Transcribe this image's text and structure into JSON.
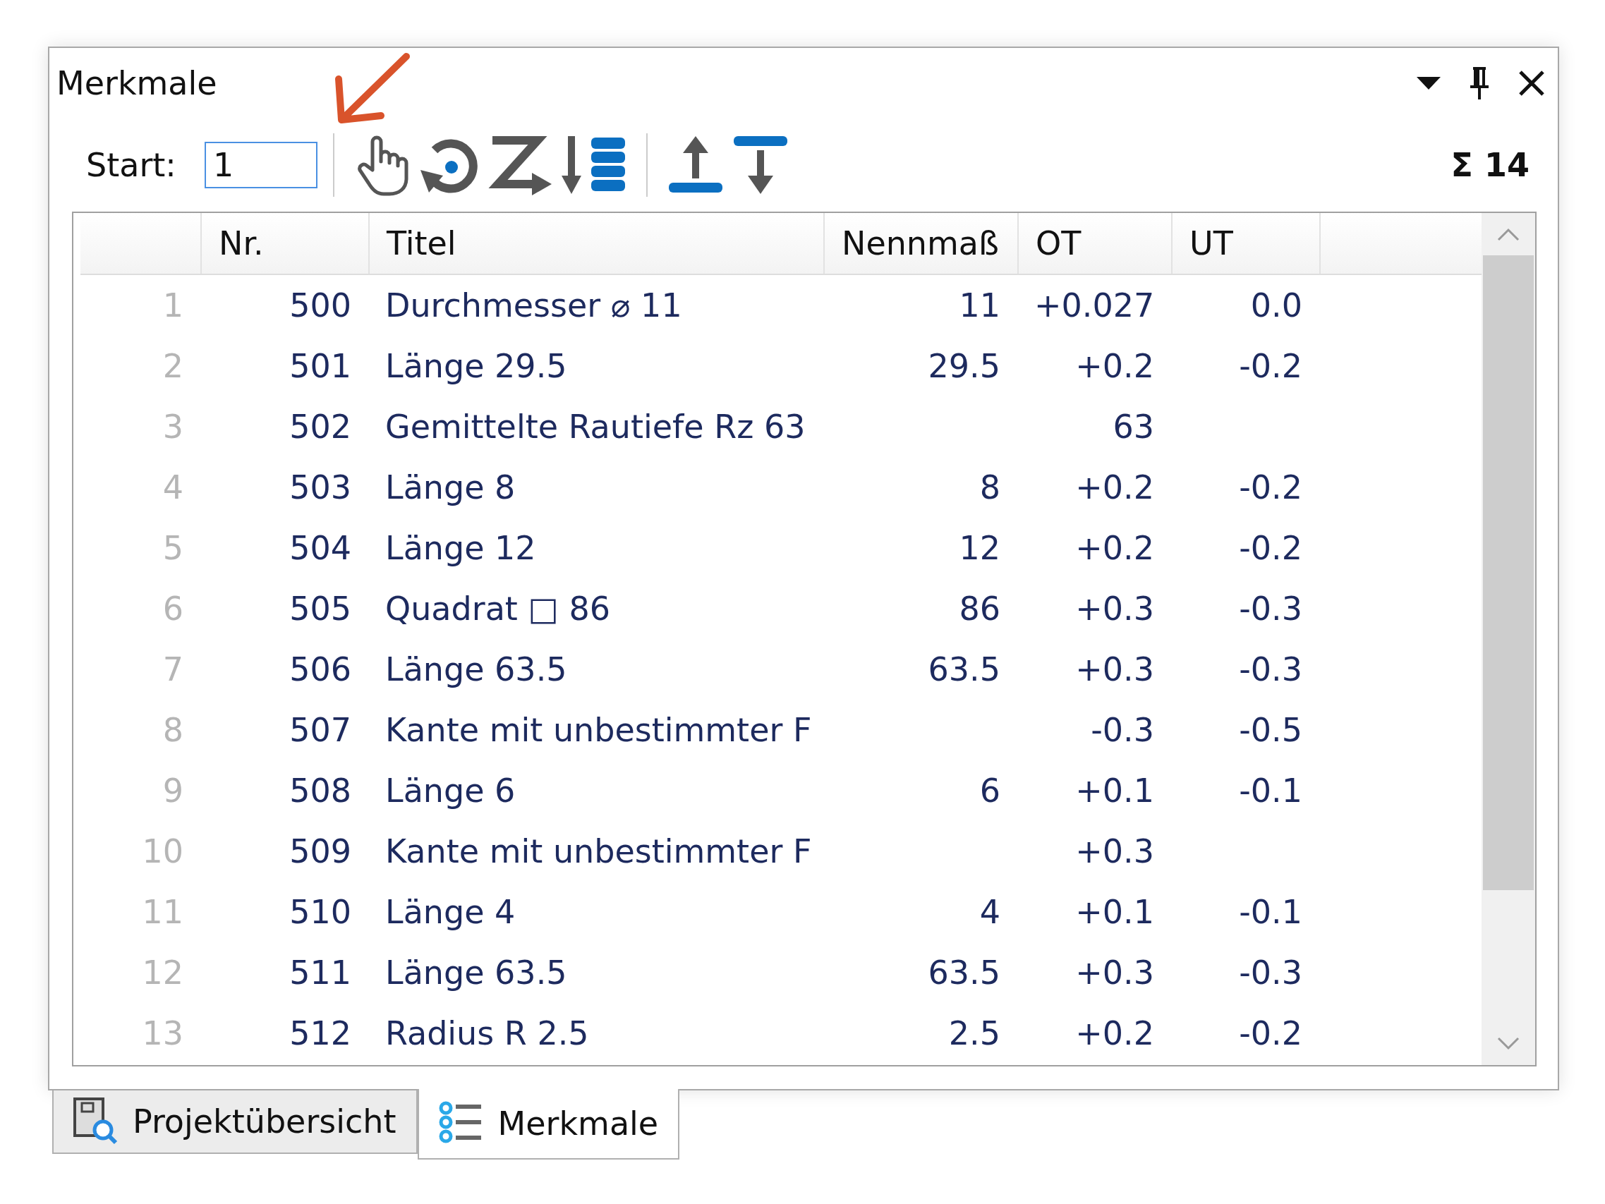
{
  "panel": {
    "title": "Merkmale"
  },
  "toolbar": {
    "start_label": "Start:",
    "start_value": "1",
    "total": "Σ 14"
  },
  "table": {
    "columns": [
      "Nr.",
      "Titel",
      "Nennmaß",
      "OT",
      "UT"
    ],
    "rows": [
      {
        "index": "1",
        "nr": "500",
        "titel": "Durchmesser ⌀ 11",
        "nennmass": "11",
        "ot": "+0.027",
        "ut": "0.0"
      },
      {
        "index": "2",
        "nr": "501",
        "titel": "Länge 29.5",
        "nennmass": "29.5",
        "ot": "+0.2",
        "ut": "-0.2"
      },
      {
        "index": "3",
        "nr": "502",
        "titel": "Gemittelte Rautiefe Rz 63",
        "nennmass": "",
        "ot": "63",
        "ut": ""
      },
      {
        "index": "4",
        "nr": "503",
        "titel": "Länge 8",
        "nennmass": "8",
        "ot": "+0.2",
        "ut": "-0.2"
      },
      {
        "index": "5",
        "nr": "504",
        "titel": "Länge 12",
        "nennmass": "12",
        "ot": "+0.2",
        "ut": "-0.2"
      },
      {
        "index": "6",
        "nr": "505",
        "titel": "Quadrat □ 86",
        "nennmass": "86",
        "ot": "+0.3",
        "ut": "-0.3"
      },
      {
        "index": "7",
        "nr": "506",
        "titel": "Länge 63.5",
        "nennmass": "63.5",
        "ot": "+0.3",
        "ut": "-0.3"
      },
      {
        "index": "8",
        "nr": "507",
        "titel": "Kante mit unbestimmter F",
        "nennmass": "",
        "ot": "-0.3",
        "ut": "-0.5"
      },
      {
        "index": "9",
        "nr": "508",
        "titel": "Länge 6",
        "nennmass": "6",
        "ot": "+0.1",
        "ut": "-0.1"
      },
      {
        "index": "10",
        "nr": "509",
        "titel": "Kante mit unbestimmter F",
        "nennmass": "",
        "ot": "+0.3",
        "ut": ""
      },
      {
        "index": "11",
        "nr": "510",
        "titel": "Länge 4",
        "nennmass": "4",
        "ot": "+0.1",
        "ut": "-0.1"
      },
      {
        "index": "12",
        "nr": "511",
        "titel": "Länge 63.5",
        "nennmass": "63.5",
        "ot": "+0.3",
        "ut": "-0.3"
      },
      {
        "index": "13",
        "nr": "512",
        "titel": "Radius R 2.5",
        "nennmass": "2.5",
        "ot": "+0.2",
        "ut": "-0.2"
      }
    ]
  },
  "tabs": [
    {
      "label": "Projektübersicht",
      "kind": "overview",
      "selected": false
    },
    {
      "label": "Merkmale",
      "kind": "features",
      "selected": true
    }
  ]
}
